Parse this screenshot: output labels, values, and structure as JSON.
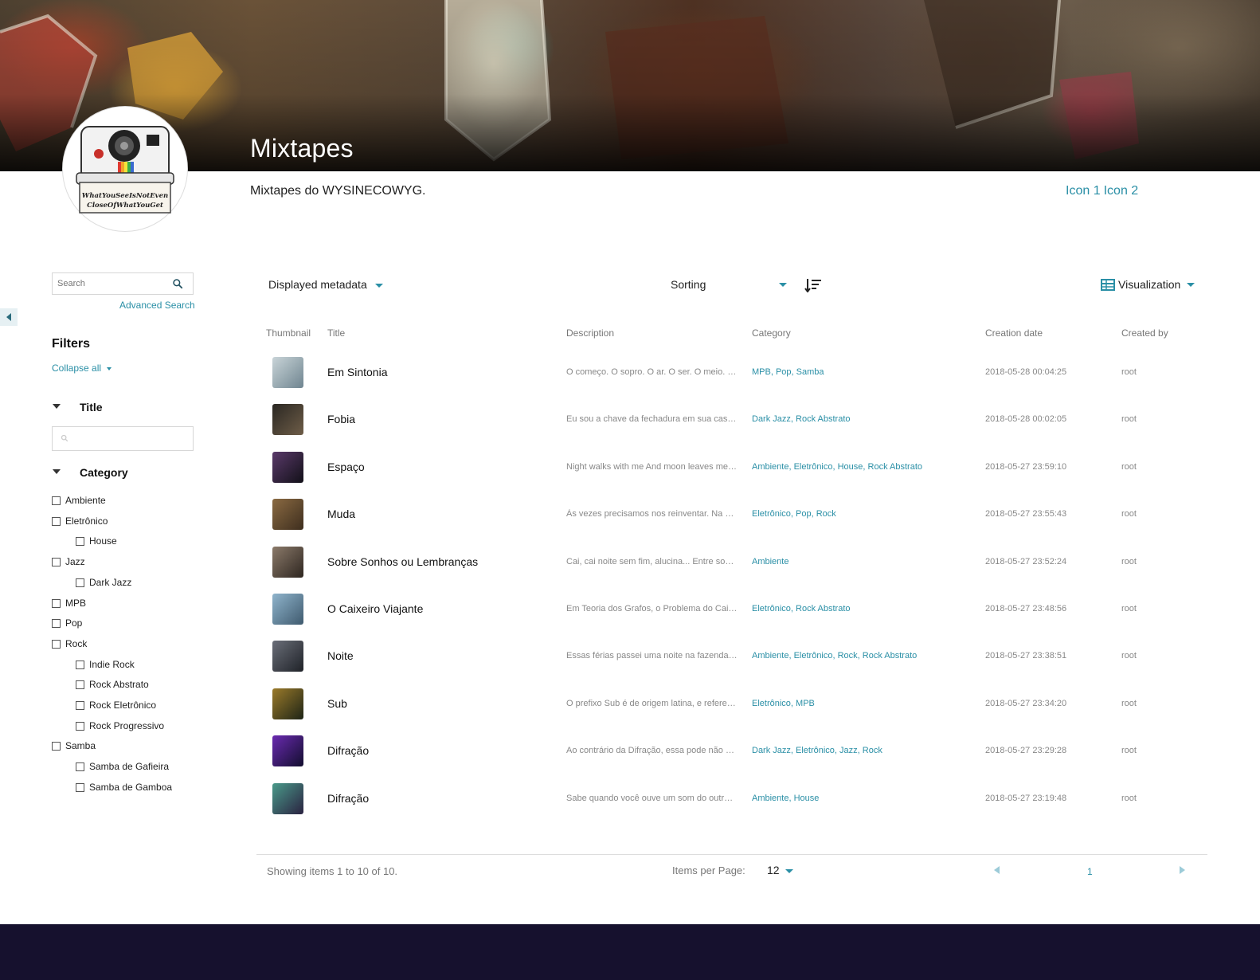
{
  "header": {
    "title": "Mixtapes",
    "description": "Mixtapes do WYSINECOWYG.",
    "links": [
      "Icon 1",
      "Icon 2"
    ],
    "logo_text_line1": "WhatYouSeeIsNotEven",
    "logo_text_line2": "CloseOfWhatYouGet"
  },
  "sidebar": {
    "search_placeholder": "Search",
    "advanced_search": "Advanced Search",
    "filters_heading": "Filters",
    "collapse_all": "Collapse all",
    "title_filter": "Title",
    "category_filter": "Category",
    "categories": [
      {
        "label": "Ambiente",
        "level": 0
      },
      {
        "label": "Eletrônico",
        "level": 0
      },
      {
        "label": "House",
        "level": 1
      },
      {
        "label": "Jazz",
        "level": 0
      },
      {
        "label": "Dark Jazz",
        "level": 1
      },
      {
        "label": "MPB",
        "level": 0
      },
      {
        "label": "Pop",
        "level": 0
      },
      {
        "label": "Rock",
        "level": 0
      },
      {
        "label": "Indie Rock",
        "level": 1
      },
      {
        "label": "Rock Abstrato",
        "level": 1
      },
      {
        "label": "Rock Eletrônico",
        "level": 1
      },
      {
        "label": "Rock Progressivo",
        "level": 1
      },
      {
        "label": "Samba",
        "level": 0
      },
      {
        "label": "Samba de Gafieira",
        "level": 1
      },
      {
        "label": "Samba de Gamboa",
        "level": 1
      }
    ]
  },
  "toolbar": {
    "displayed_metadata": "Displayed metadata",
    "sorting": "Sorting",
    "visualization": "Visualization"
  },
  "table": {
    "columns": [
      "Thumbnail",
      "Title",
      "Description",
      "Category",
      "Creation date",
      "Created by"
    ],
    "rows": [
      {
        "title": "Em Sintonia",
        "description": "O começo. O sopro. O ar. O ser. O meio. O fim.",
        "category": "MPB, Pop, Samba",
        "date": "2018-05-28 00:04:25",
        "by": "root",
        "thumb_colors": [
          "#c9d4d8",
          "#6f8590"
        ]
      },
      {
        "title": "Fobia",
        "description": "Eu sou a chave da fechadura em sua casa de medo",
        "category": "Dark Jazz, Rock Abstrato",
        "date": "2018-05-28 00:02:05",
        "by": "root",
        "thumb_colors": [
          "#2a2722",
          "#6e5d48"
        ]
      },
      {
        "title": "Espaço",
        "description": "Night walks with me And moon leaves me just alone",
        "category": "Ambiente, Eletrônico, House, Rock Abstrato",
        "date": "2018-05-27 23:59:10",
        "by": "root",
        "thumb_colors": [
          "#5a3a6a",
          "#121018"
        ]
      },
      {
        "title": "Muda",
        "description": "Às vezes precisamos nos reinventar. Na caminhada",
        "category": "Eletrônico, Pop, Rock",
        "date": "2018-05-27 23:55:43",
        "by": "root",
        "thumb_colors": [
          "#8a6a42",
          "#3e2e1e"
        ]
      },
      {
        "title": "Sobre Sonhos ou Lembranças",
        "description": "Cai, cai noite sem fim, alucina... Entre sonhos",
        "category": "Ambiente",
        "date": "2018-05-27 23:52:24",
        "by": "root",
        "thumb_colors": [
          "#8b7a6a",
          "#2e2620"
        ]
      },
      {
        "title": "O Caixeiro Viajante",
        "description": "Em Teoria dos Grafos, o Problema do Caixeiro",
        "category": "Eletrônico, Rock Abstrato",
        "date": "2018-05-27 23:48:56",
        "by": "root",
        "thumb_colors": [
          "#8fb4cc",
          "#3f5a6e"
        ]
      },
      {
        "title": "Noite",
        "description": "Essas férias passei uma noite na fazenda de",
        "category": "Ambiente, Eletrônico, Rock, Rock Abstrato",
        "date": "2018-05-27 23:38:51",
        "by": "root",
        "thumb_colors": [
          "#6a6e78",
          "#1f2228"
        ]
      },
      {
        "title": "Sub",
        "description": "O prefixo Sub é de origem latina, e refere-se a",
        "category": "Eletrônico, MPB",
        "date": "2018-05-27 23:34:20",
        "by": "root",
        "thumb_colors": [
          "#9a7a2a",
          "#1e2416"
        ]
      },
      {
        "title": "Difração",
        "description": "Ao contrário da Difração, essa pode não ser",
        "category": "Dark Jazz, Eletrônico, Jazz, Rock",
        "date": "2018-05-27 23:29:28",
        "by": "root",
        "thumb_colors": [
          "#6a2ab0",
          "#120e2e"
        ]
      },
      {
        "title": "Difração",
        "description": "Sabe quando você ouve um som do outro lado",
        "category": "Ambiente, House",
        "date": "2018-05-27 23:19:48",
        "by": "root",
        "thumb_colors": [
          "#4a9a8a",
          "#2a2240"
        ]
      }
    ]
  },
  "pagination": {
    "showing": "Showing items 1 to 10 of 10.",
    "items_per_page_label": "Items per Page:",
    "items_per_page": "12",
    "current_page": "1"
  },
  "colors": {
    "accent": "#2a8fa6",
    "footer": "#16112e"
  }
}
